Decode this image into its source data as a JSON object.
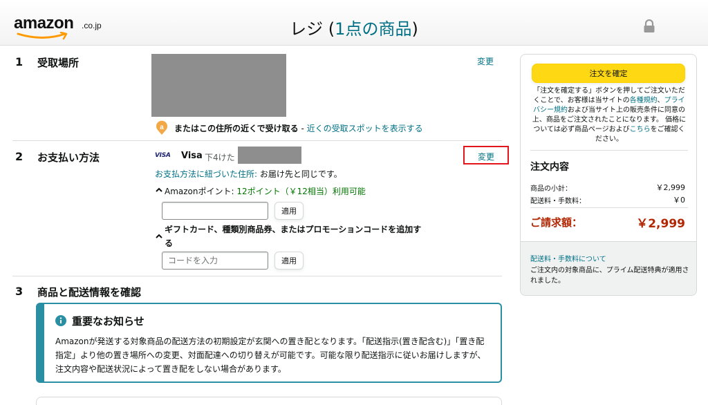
{
  "header": {
    "logo_word": "amazon",
    "logo_tld": ".co.jp",
    "title_prefix": "レジ (",
    "title_link": "1点の商品",
    "title_suffix": ")"
  },
  "sections": {
    "pickup": {
      "num": "1",
      "heading": "受取場所",
      "change": "変更",
      "nearby_text": "またはこの住所の近くで受け取る",
      "separator": " - ",
      "nearby_link": "近くの受取スポットを表示する"
    },
    "payment": {
      "num": "2",
      "heading": "お支払い方法",
      "change": "変更",
      "card_logo": "VISA",
      "card_name": "Visa",
      "card_digits": "下4けた",
      "billing_link": "お支払方法に紐づいた住所:",
      "billing_text": " お届け先と同じです。",
      "points_label": "Amazonポイント: ",
      "points_value": "12ポイント（￥12相当）利用可能",
      "apply_label": "適用",
      "gift_label": "ギフトカード、種類別商品券、またはプロモーションコードを追加する",
      "code_placeholder": "コードを入力",
      "apply_label_2": "適用"
    },
    "review": {
      "num": "3",
      "heading": "商品と配送情報を確認",
      "notice_title": "重要なお知らせ",
      "notice_body": "Amazonが発送する対象商品の配送方法の初期設定が玄関への置き配となります。「配送指示(置き配含む)」「置き配指定」より他の置き場所への変更、対面配達への切り替えが可能です。可能な限り配送指示に従いお届けしますが、注文内容や配送状況によって置き配をしない場合があります。"
    }
  },
  "summary": {
    "confirm_button": "注文を確定",
    "notice_1": "「注文を確定する」ボタンを押してご注文いただくことで、お客様は当サイトの",
    "terms_link": "各種規約",
    "notice_2": "、",
    "privacy_link": "プライバシー規約",
    "notice_3": "および当サイト上の販売条件に同意の上、商品をご注文されたことになります。 価格については必ず商品ページおよび",
    "here_link": "こちら",
    "notice_4": "をご確認ください。",
    "order_heading": "注文内容",
    "subtotal_label": "商品の小計：",
    "subtotal_value": "￥2,999",
    "shipping_label": "配送料・手数料：",
    "shipping_value": "￥0",
    "total_label": "ご請求額：",
    "total_value": "￥2,999",
    "shipping_info_link": "配送料・手数料について",
    "shipping_info_text": "ご注文内の対象商品に、プライム配送特典が適用されました。"
  },
  "colors": {
    "link": "#007185",
    "confirm_button": "#ffd814",
    "price": "#b12704",
    "points": "#007600",
    "highlight": "#e3141c",
    "notice_border": "#2a8fa3"
  }
}
